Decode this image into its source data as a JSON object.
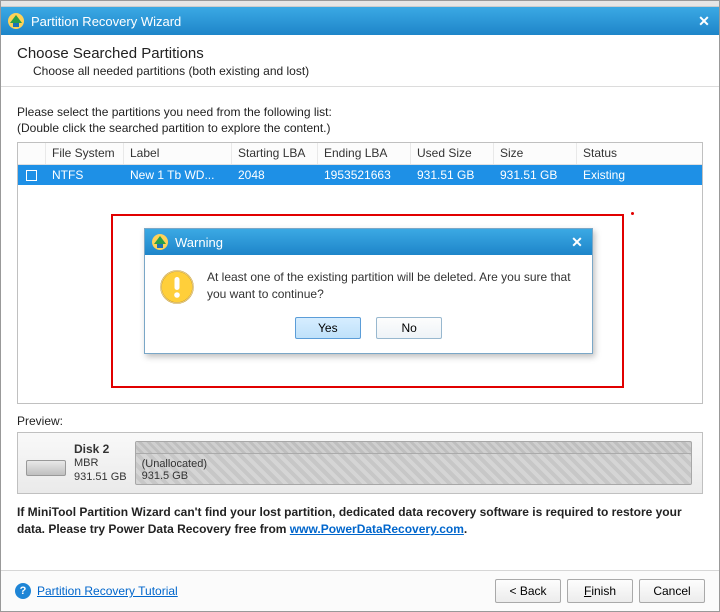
{
  "window": {
    "title": "Partition Recovery Wizard"
  },
  "header": {
    "title": "Choose Searched Partitions",
    "subtitle": "Choose all needed partitions (both existing and lost)"
  },
  "instructions": {
    "line1": "Please select the partitions you need from the following list:",
    "line2": "(Double click the searched partition to explore the content.)"
  },
  "table": {
    "columns": {
      "checkbox": "",
      "file_system": "File System",
      "label": "Label",
      "starting_lba": "Starting LBA",
      "ending_lba": "Ending LBA",
      "used_size": "Used Size",
      "size": "Size",
      "status": "Status"
    },
    "rows": [
      {
        "checked": false,
        "file_system": "NTFS",
        "label": "New 1 Tb WD...",
        "starting_lba": "2048",
        "ending_lba": "1953521663",
        "used_size": "931.51 GB",
        "size": "931.51 GB",
        "status": "Existing"
      }
    ]
  },
  "warning_dialog": {
    "title": "Warning",
    "message": "At least one of the existing partition will be deleted. Are you sure that you want to continue?",
    "yes": "Yes",
    "no": "No",
    "icon": "warning-icon"
  },
  "preview": {
    "label": "Preview:",
    "disk": {
      "name": "Disk 2",
      "type": "MBR",
      "size": "931.51 GB"
    },
    "space": {
      "label": "(Unallocated)",
      "size": "931.5 GB"
    }
  },
  "note": {
    "prefix_bold": "If MiniTool Partition Wizard can't find your lost partition, dedicated data recovery software is required to restore your data. Please try Power Data Recovery free from ",
    "link_text": "www.PowerDataRecovery.com",
    "suffix_bold": "."
  },
  "footer": {
    "tutorial_link": "Partition Recovery Tutorial",
    "back": "< Back",
    "finish_plain": "inish",
    "finish_mnemonic": "F",
    "cancel": "Cancel"
  }
}
